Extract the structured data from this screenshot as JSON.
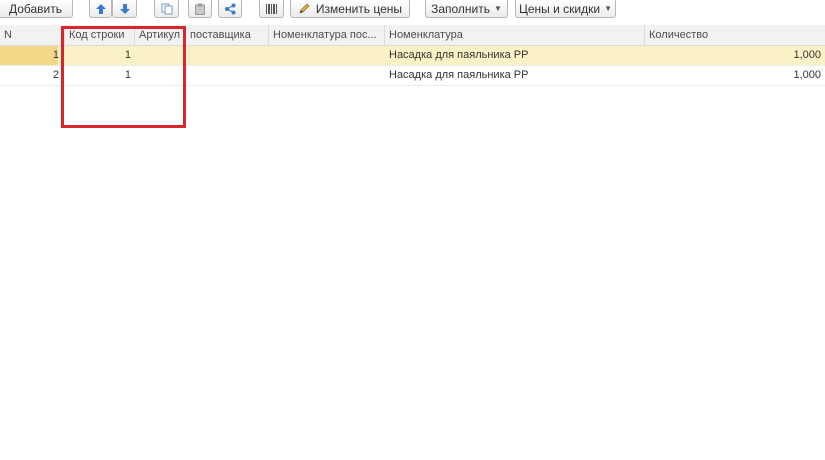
{
  "toolbar": {
    "add_label": "Добавить",
    "change_prices_label": "Изменить цены",
    "fill_label": "Заполнить",
    "prices_discounts_label": "Цены и скидки"
  },
  "columns": {
    "n": "N",
    "line_code": "Код строки",
    "article": "Артикул",
    "supplier": "поставщика",
    "supplier_nomenclature": "Номенклатура пос...",
    "nomenclature": "Номенклатура",
    "quantity": "Количество"
  },
  "rows": [
    {
      "n": "1",
      "line_code": "1",
      "article": "",
      "supplier_nomenclature": "",
      "nomenclature": "Насадка для паяльника PP",
      "quantity": "1,000",
      "selected": true
    },
    {
      "n": "2",
      "line_code": "1",
      "article": "",
      "supplier_nomenclature": "",
      "nomenclature": "Насадка для паяльника PP",
      "quantity": "1,000",
      "selected": false
    }
  ],
  "icons": [
    "arrow-up-icon",
    "arrow-down-icon",
    "copy-icon",
    "paste-icon",
    "share-icon",
    "barcode-icon",
    "pencil-icon"
  ],
  "colors": {
    "highlight_box": "#d9262e",
    "selected_row": "#fbf1c6",
    "arrow_blue": "#3a7bd5"
  }
}
